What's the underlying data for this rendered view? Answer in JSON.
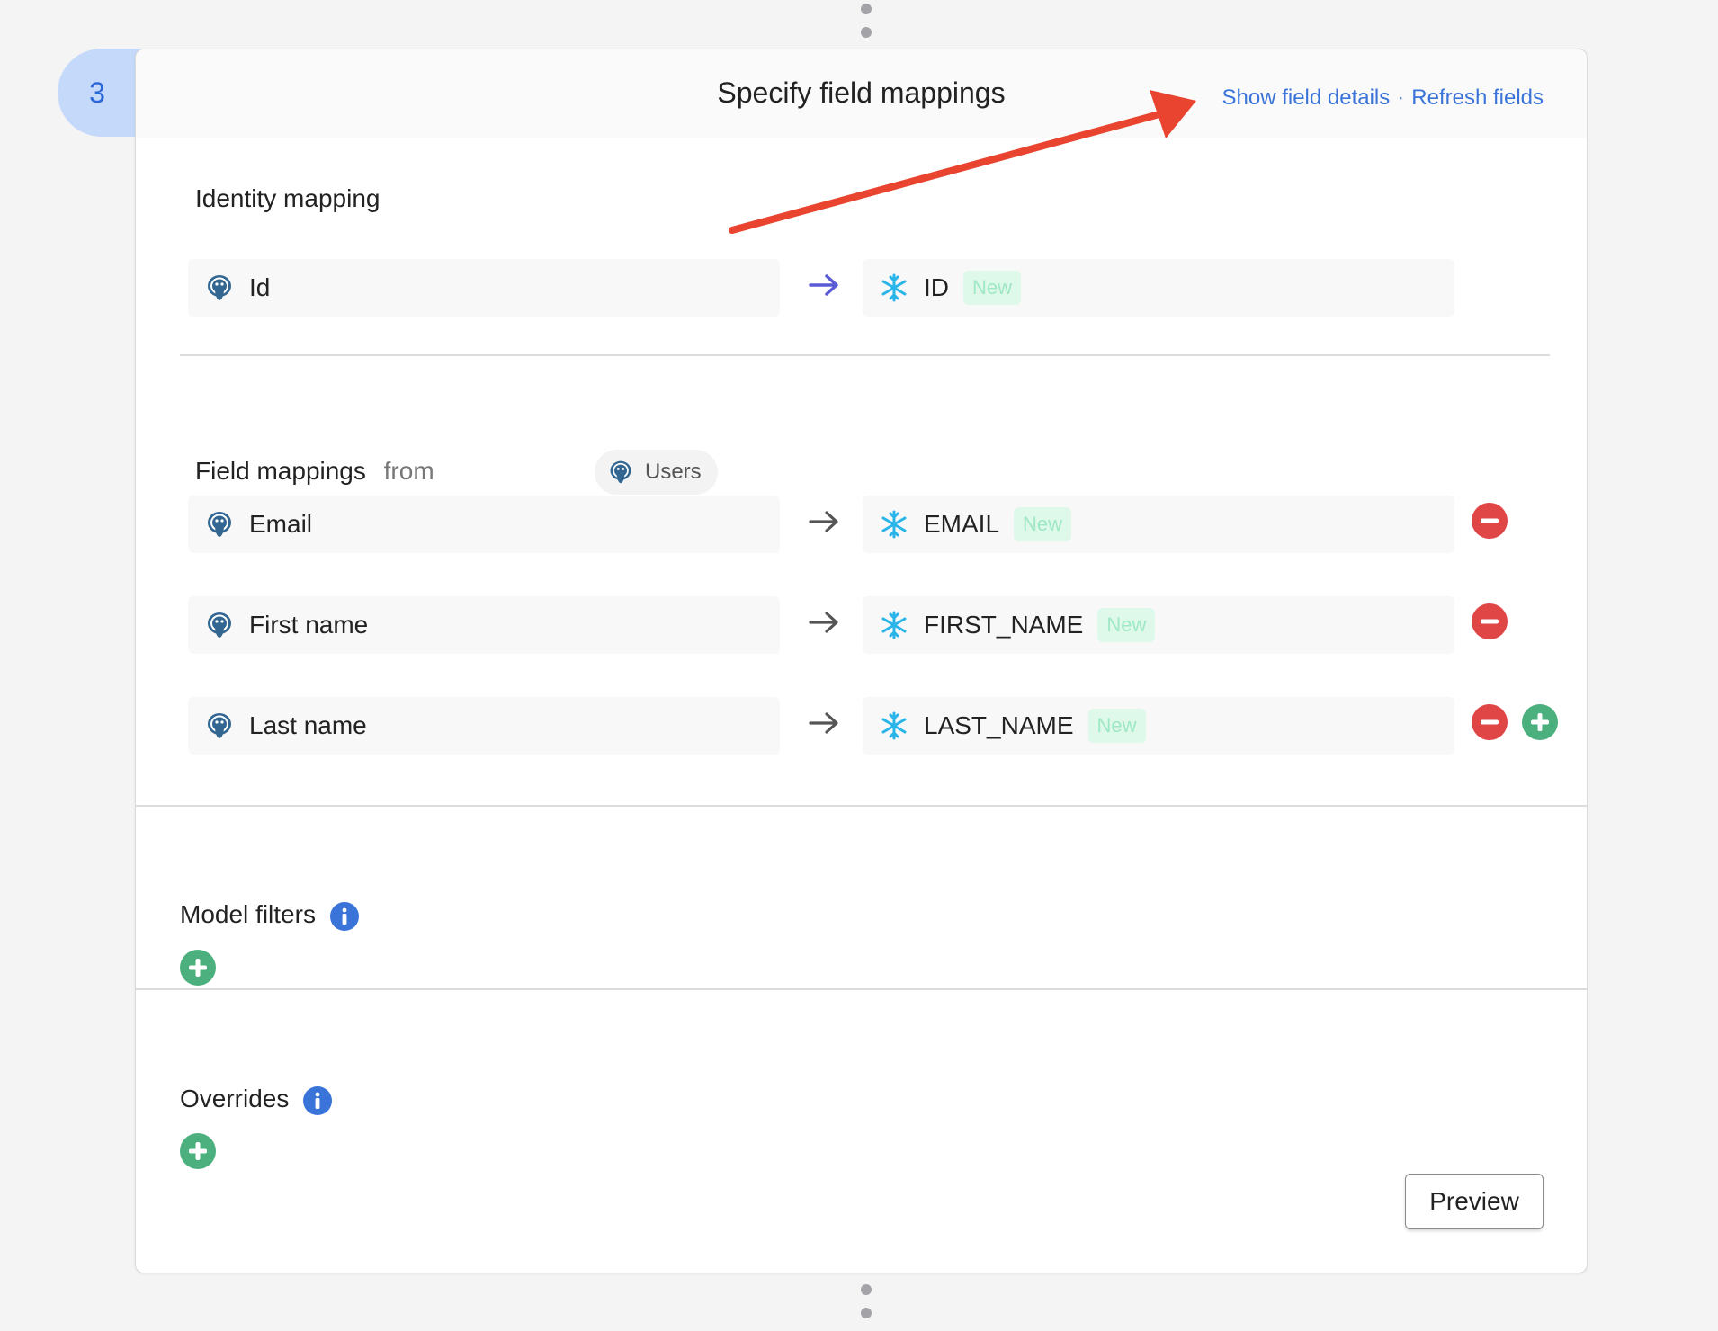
{
  "step": {
    "number": "3"
  },
  "header": {
    "title": "Specify field mappings",
    "show_details": "Show field details",
    "separator": "·",
    "refresh": "Refresh fields"
  },
  "identity": {
    "heading": "Identity mapping",
    "source": "Id",
    "dest": "ID",
    "dest_badge": "New"
  },
  "mappings": {
    "heading": "Field mappings",
    "from_word": "from",
    "model": "Users",
    "rows": [
      {
        "source": "Email",
        "dest": "EMAIL",
        "badge": "New"
      },
      {
        "source": "First name",
        "dest": "FIRST_NAME",
        "badge": "New"
      },
      {
        "source": "Last name",
        "dest": "LAST_NAME",
        "badge": "New"
      }
    ]
  },
  "filters": {
    "heading": "Model filters"
  },
  "overrides": {
    "heading": "Overrides"
  },
  "actions": {
    "preview": "Preview"
  },
  "colors": {
    "accent": "#3a74d9",
    "remove": "#e04646",
    "add": "#4cb07e",
    "annotation_arrow": "#e84430"
  }
}
